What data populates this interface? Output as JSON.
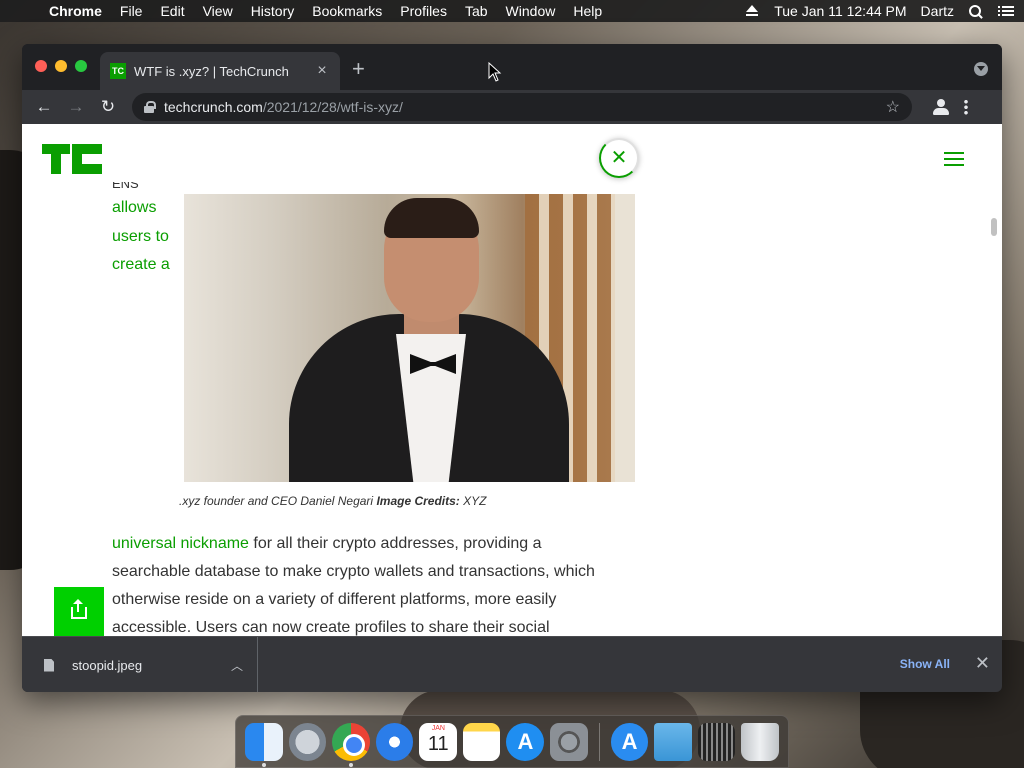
{
  "menubar": {
    "app": "Chrome",
    "items": [
      "File",
      "Edit",
      "View",
      "History",
      "Bookmarks",
      "Profiles",
      "Tab",
      "Window",
      "Help"
    ],
    "clock": "Tue Jan 11  12:44 PM",
    "user": "Dartz"
  },
  "browser": {
    "tab_title": "WTF is .xyz? | TechCrunch",
    "tab_favicon": "TC",
    "new_tab_label": "+",
    "url_domain": "techcrunch.com",
    "url_path": "/2021/12/28/wtf-is-xyz/"
  },
  "page": {
    "side_cut": "ENS",
    "side_lines": [
      "allows",
      "users to",
      "create a"
    ],
    "caption_prefix": ".xyz founder and CEO Daniel Negari ",
    "caption_credits_label": "Image Credits:",
    "caption_credits_value": " XYZ",
    "body_link": "universal nickname",
    "body_text": " for all their crypto addresses, providing a searchable database to make crypto wallets and transactions, which otherwise reside on a variety of different platforms, more easily accessible. Users can now create profiles to share their social"
  },
  "download_shelf": {
    "file_name": "stoopid.jpeg",
    "show_all": "Show All"
  },
  "dock": {
    "calendar_month": "JAN",
    "calendar_day": "11"
  },
  "colors": {
    "tc_green": "#0a9e01",
    "chrome_dark": "#202124"
  }
}
